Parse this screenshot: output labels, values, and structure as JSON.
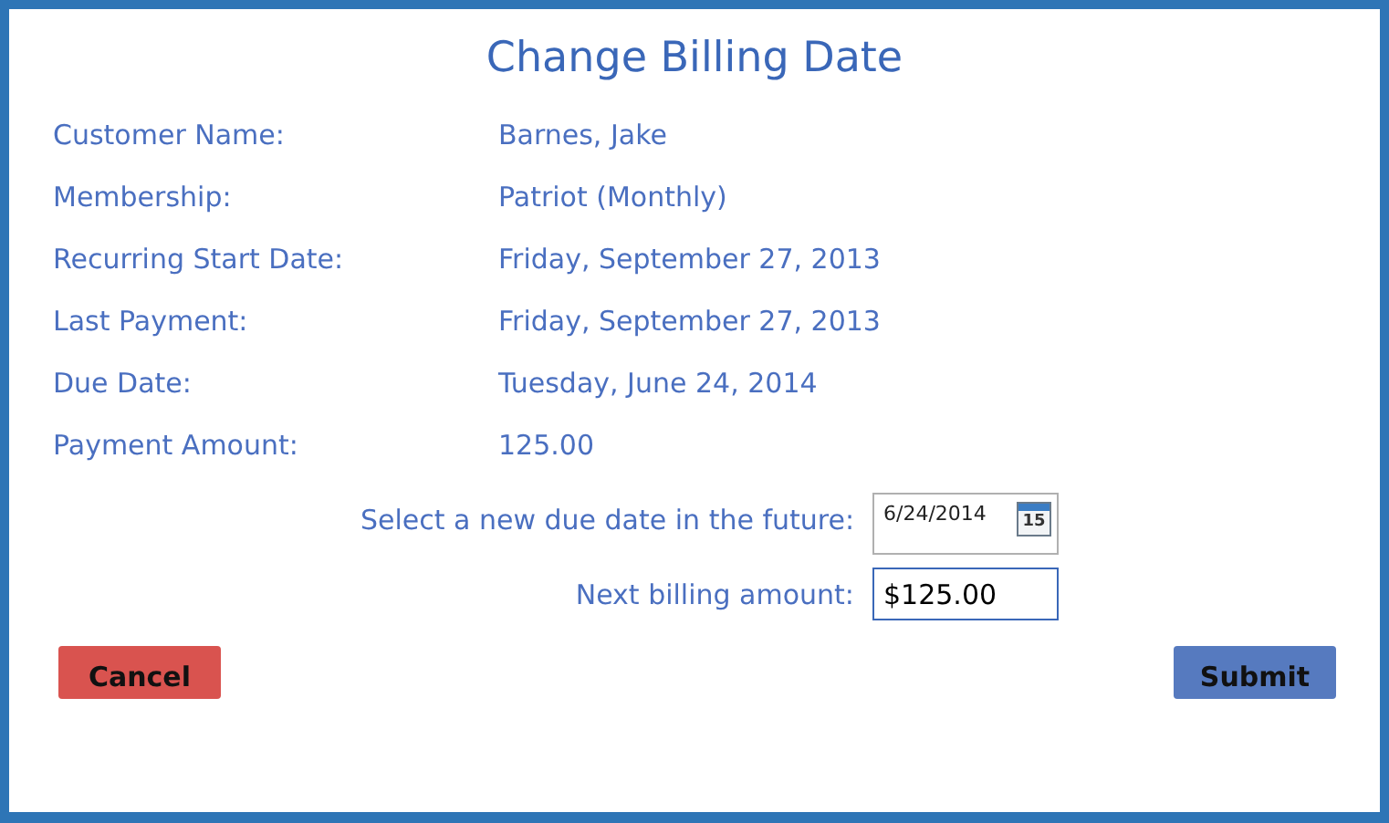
{
  "dialog": {
    "title": "Change Billing Date"
  },
  "details": [
    {
      "label": "Customer Name:",
      "value": "Barnes, Jake"
    },
    {
      "label": "Membership:",
      "value": "Patriot (Monthly)"
    },
    {
      "label": "Recurring Start Date:",
      "value": "Friday, September 27, 2013"
    },
    {
      "label": "Last Payment:",
      "value": "Friday, September 27, 2013"
    },
    {
      "label": "Due Date:",
      "value": "Tuesday, June 24, 2014"
    },
    {
      "label": "Payment Amount:",
      "value": "125.00"
    }
  ],
  "fields": [
    {
      "kind": "date",
      "label": "Select a new due date in the future:",
      "value": "6/24/2014",
      "calendar_day": "15"
    },
    {
      "kind": "text",
      "label": "Next billing amount:",
      "value": "$125.00"
    }
  ],
  "buttons": [
    {
      "kind": "cancel",
      "label": "Cancel"
    },
    {
      "kind": "submit",
      "label": "Submit"
    }
  ]
}
